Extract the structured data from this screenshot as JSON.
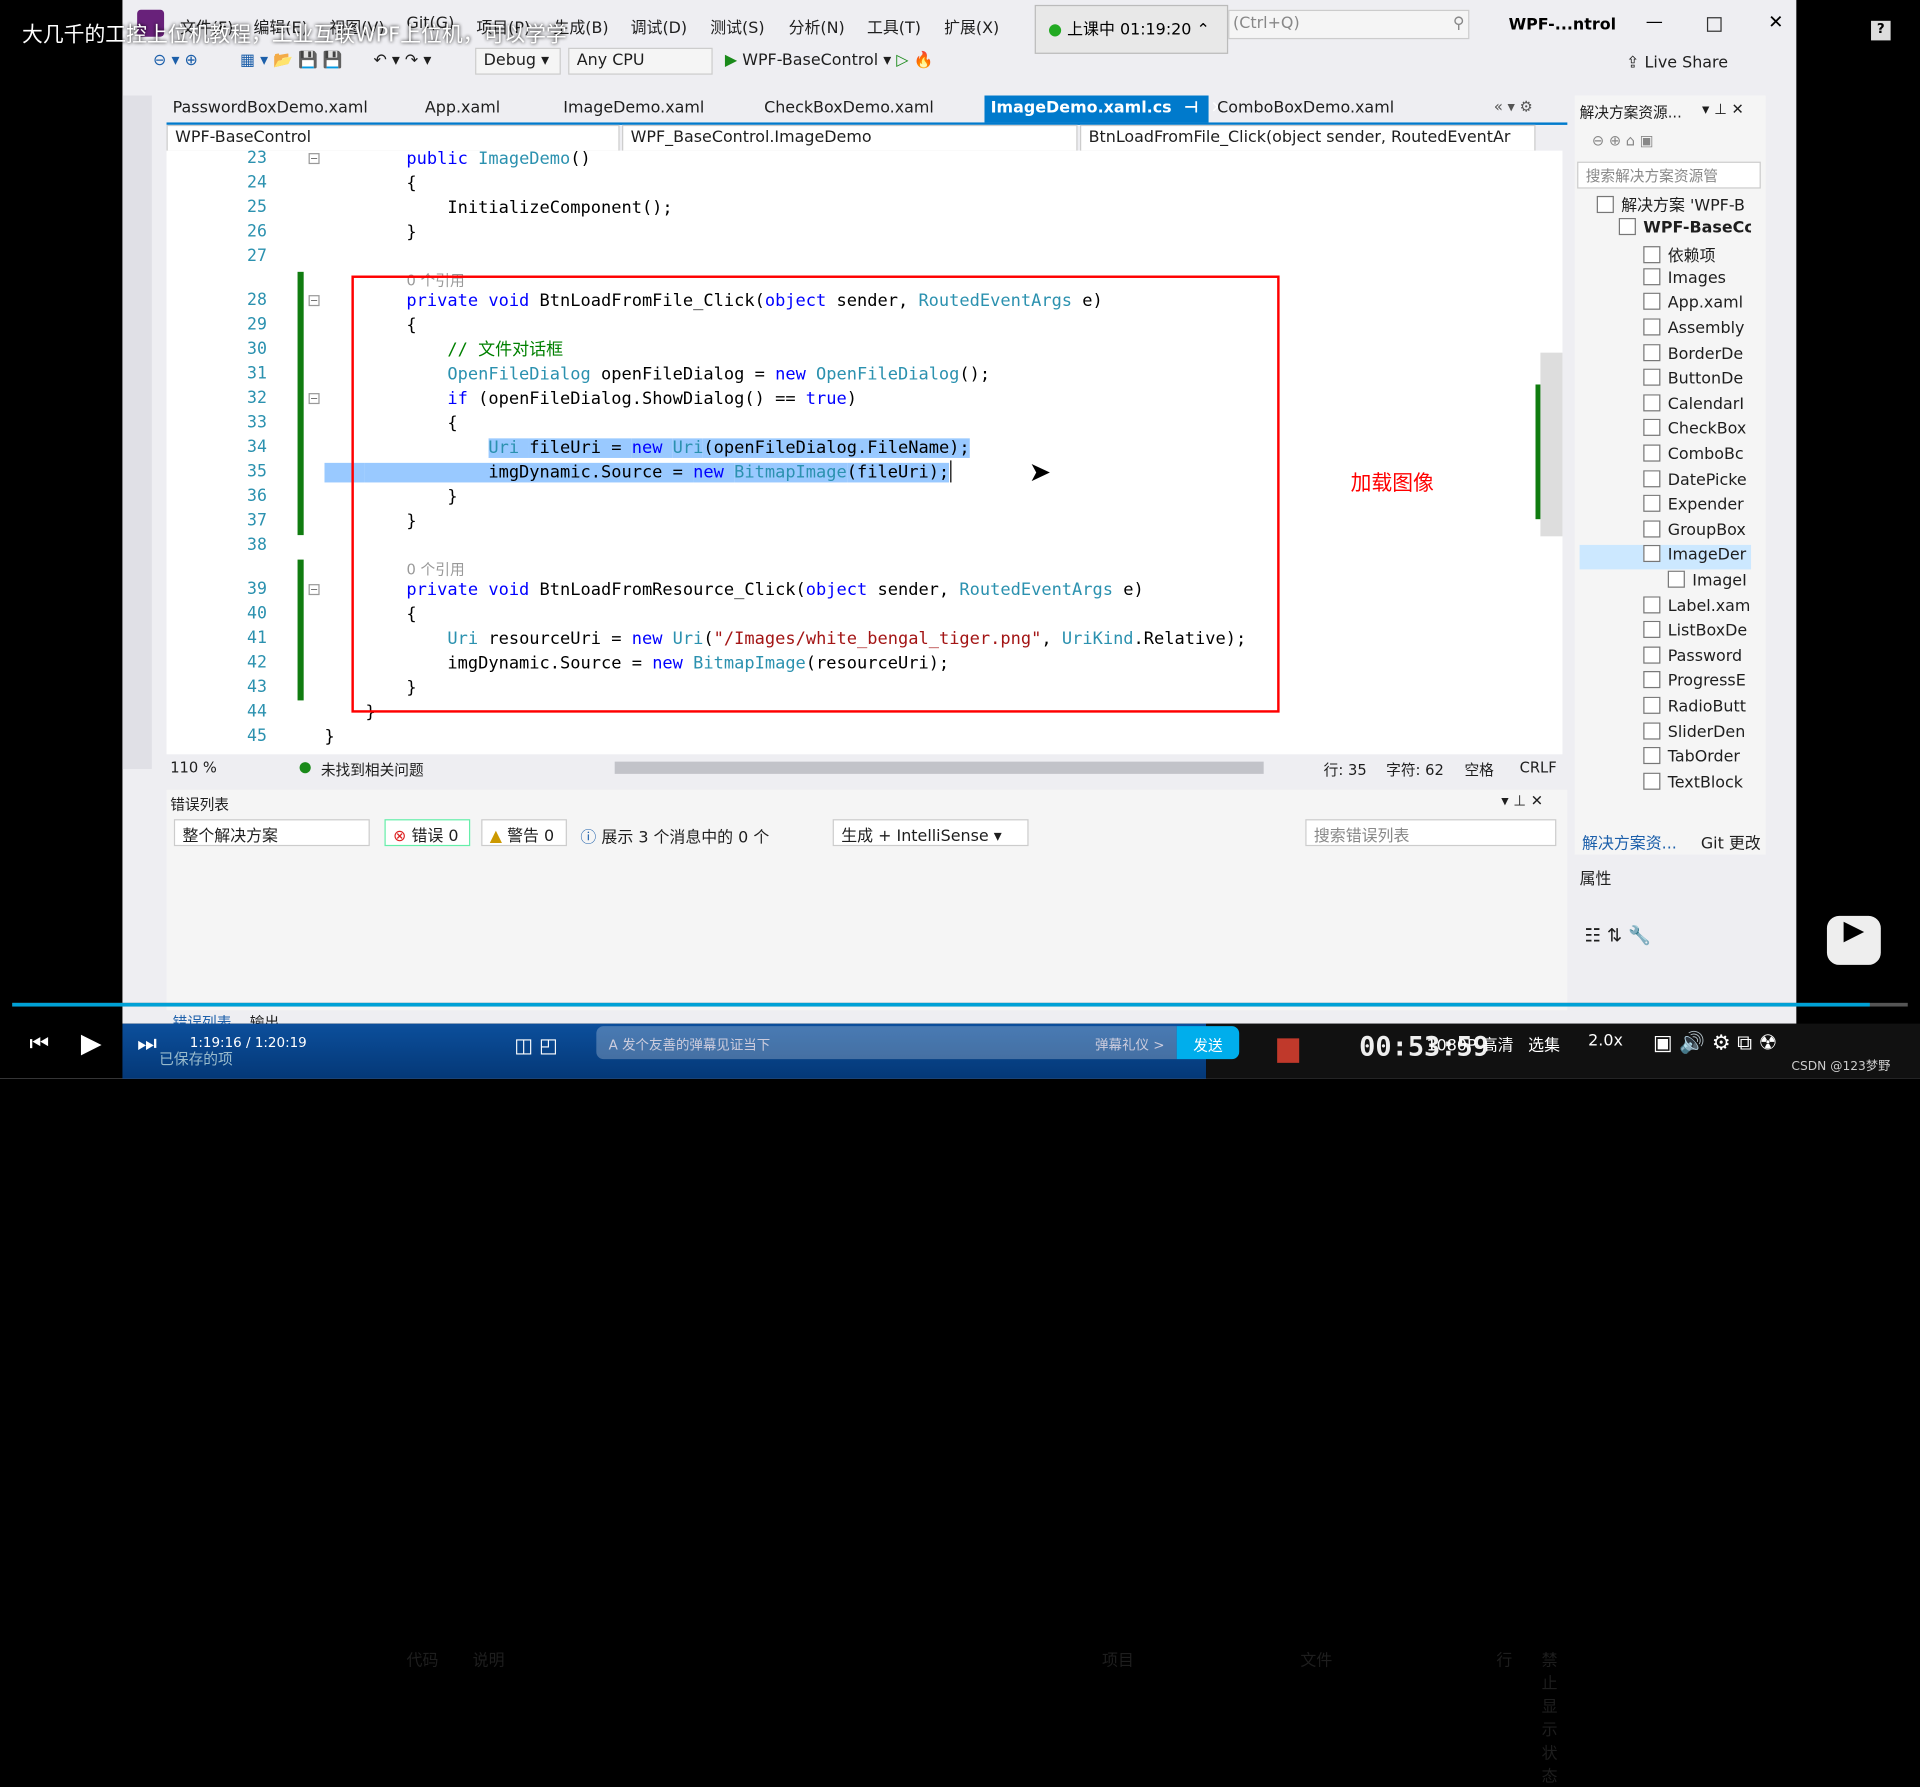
{
  "video_title": "大几千的工控上位机教程，工业互联WPF上位机，可以学学",
  "menu": [
    "文件(F)",
    "编辑(E)",
    "视图(V)",
    "Git(G)",
    "项目(P)",
    "生成(B)",
    "调试(D)",
    "测试(S)",
    "分析(N)",
    "工具(T)",
    "扩展(X)"
  ],
  "live_badge": "上课中 01:19:20",
  "search_hint": "(Ctrl+Q)",
  "window_title": "WPF-...ntrol",
  "toolbar": {
    "config": "Debug",
    "platform": "Any CPU",
    "start": "WPF-BaseControl",
    "live_share": "Live Share"
  },
  "tabs": [
    {
      "label": "PasswordBoxDemo.xaml"
    },
    {
      "label": "App.xaml"
    },
    {
      "label": "ImageDemo.xaml"
    },
    {
      "label": "CheckBoxDemo.xaml"
    },
    {
      "label": "ImageDemo.xaml.cs",
      "active": true
    },
    {
      "label": "ComboBoxDemo.xaml"
    }
  ],
  "navbar": {
    "project": "WPF-BaseControl",
    "class": "WPF_BaseControl.ImageDemo",
    "member": "BtnLoadFromFile_Click(object sender, RoutedEventAr"
  },
  "code": [
    {
      "n": "23",
      "t": [
        [
          "        "
        ],
        [
          "public ",
          "kw"
        ],
        [
          "ImageDemo",
          "ty"
        ],
        [
          "()"
        ]
      ]
    },
    {
      "n": "24",
      "t": [
        [
          "        {"
        ]
      ]
    },
    {
      "n": "25",
      "t": [
        [
          "            InitializeComponent();"
        ]
      ]
    },
    {
      "n": "26",
      "t": [
        [
          "        }"
        ]
      ]
    },
    {
      "n": "27",
      "t": [
        [
          ""
        ]
      ]
    },
    {
      "lens": "0 个引用"
    },
    {
      "n": "28",
      "t": [
        [
          "        "
        ],
        [
          "private void ",
          "kw"
        ],
        [
          "BtnLoadFromFile_Click("
        ],
        [
          "object ",
          "kw"
        ],
        [
          "sender, "
        ],
        [
          "RoutedEventArgs ",
          "ty"
        ],
        [
          "e)"
        ]
      ]
    },
    {
      "n": "29",
      "t": [
        [
          "        {"
        ]
      ]
    },
    {
      "n": "30",
      "t": [
        [
          "            "
        ],
        [
          "// 文件对话框",
          "cm"
        ]
      ]
    },
    {
      "n": "31",
      "t": [
        [
          "            "
        ],
        [
          "OpenFileDialog ",
          "ty"
        ],
        [
          "openFileDialog = "
        ],
        [
          "new ",
          "kw"
        ],
        [
          "OpenFileDialog",
          "ty"
        ],
        [
          "();"
        ]
      ]
    },
    {
      "n": "32",
      "t": [
        [
          "            "
        ],
        [
          "if ",
          "kw"
        ],
        [
          "(openFileDialog.ShowDialog() == "
        ],
        [
          "true",
          "kw"
        ],
        [
          ")"
        ]
      ]
    },
    {
      "n": "33",
      "t": [
        [
          "            {"
        ]
      ]
    },
    {
      "n": "34",
      "t": [
        [
          "                "
        ],
        [
          "Uri ",
          "ty sel"
        ],
        [
          "fileUri = ",
          "sel"
        ],
        [
          "new ",
          "kw sel"
        ],
        [
          "Uri",
          "ty sel"
        ],
        [
          "(openFileDialog.FileName);",
          "sel"
        ]
      ]
    },
    {
      "n": "35",
      "t": [
        [
          "    ",
          "sel"
        ],
        [
          "            imgDynamic.Source = ",
          "sel"
        ],
        [
          "new ",
          "kw sel"
        ],
        [
          "BitmapImage",
          "ty sel"
        ],
        [
          "(fileUri);",
          "sel"
        ]
      ]
    },
    {
      "n": "36",
      "t": [
        [
          "            }"
        ]
      ]
    },
    {
      "n": "37",
      "t": [
        [
          "        }"
        ]
      ]
    },
    {
      "n": "38",
      "t": [
        [
          ""
        ]
      ]
    },
    {
      "lens": "0 个引用"
    },
    {
      "n": "39",
      "t": [
        [
          "        "
        ],
        [
          "private void ",
          "kw"
        ],
        [
          "BtnLoadFromResource_Click("
        ],
        [
          "object ",
          "kw"
        ],
        [
          "sender, "
        ],
        [
          "RoutedEventArgs ",
          "ty"
        ],
        [
          "e)"
        ]
      ]
    },
    {
      "n": "40",
      "t": [
        [
          "        {"
        ]
      ]
    },
    {
      "n": "41",
      "t": [
        [
          "            "
        ],
        [
          "Uri ",
          "ty"
        ],
        [
          "resourceUri = "
        ],
        [
          "new ",
          "kw"
        ],
        [
          "Uri",
          "ty"
        ],
        [
          "("
        ],
        [
          "\"/Images/white_bengal_tiger.png\"",
          "st"
        ],
        [
          ", "
        ],
        [
          "UriKind",
          "ty"
        ],
        [
          ".Relative);"
        ]
      ]
    },
    {
      "n": "42",
      "t": [
        [
          "            imgDynamic.Source = "
        ],
        [
          "new ",
          "kw"
        ],
        [
          "BitmapImage",
          "ty"
        ],
        [
          "(resourceUri);"
        ]
      ]
    },
    {
      "n": "43",
      "t": [
        [
          "        }"
        ]
      ]
    },
    {
      "n": "44",
      "t": [
        [
          "    }"
        ]
      ]
    },
    {
      "n": "45",
      "t": [
        [
          "}"
        ]
      ]
    }
  ],
  "annotation": "加载图像",
  "status": {
    "zoom": "110 %",
    "issues": "未找到相关问题",
    "line": "行: 35",
    "char": "字符: 62",
    "space": "空格",
    "eol": "CRLF"
  },
  "error_list": {
    "title": "错误列表",
    "scope": "整个解决方案",
    "errors": "错误 0",
    "warnings": "警告 0",
    "messages": "展示 3 个消息中的 0 个",
    "source": "生成 + IntelliSense",
    "search": "搜索错误列表",
    "columns": [
      "代码",
      "说明",
      "项目",
      "文件",
      "行",
      "禁止显示状态"
    ]
  },
  "bottom_tabs": [
    "错误列表",
    "输出"
  ],
  "solution_explorer": {
    "title": "解决方案资源...",
    "search": "搜索解决方案资源管",
    "items": [
      {
        "label": "解决方案 'WPF-B",
        "lvl": 0
      },
      {
        "label": "WPF-BaseCc",
        "lvl": 0,
        "bold": true
      },
      {
        "label": "依赖项",
        "lvl": 1
      },
      {
        "label": "Images",
        "lvl": 1
      },
      {
        "label": "App.xaml",
        "lvl": 1
      },
      {
        "label": "Assembly",
        "lvl": 1
      },
      {
        "label": "BorderDe",
        "lvl": 1
      },
      {
        "label": "ButtonDe",
        "lvl": 1
      },
      {
        "label": "CalendarI",
        "lvl": 1
      },
      {
        "label": "CheckBox",
        "lvl": 1
      },
      {
        "label": "ComboBc",
        "lvl": 1
      },
      {
        "label": "DatePicke",
        "lvl": 1
      },
      {
        "label": "Expender",
        "lvl": 1
      },
      {
        "label": "GroupBox",
        "lvl": 1
      },
      {
        "label": "ImageDer",
        "lvl": 1,
        "selected": true
      },
      {
        "label": "ImageI",
        "lvl": 2
      },
      {
        "label": "Label.xam",
        "lvl": 1
      },
      {
        "label": "ListBoxDe",
        "lvl": 1
      },
      {
        "label": "Password",
        "lvl": 1
      },
      {
        "label": "ProgressE",
        "lvl": 1
      },
      {
        "label": "RadioButt",
        "lvl": 1
      },
      {
        "label": "SliderDen",
        "lvl": 1
      },
      {
        "label": "TabOrder",
        "lvl": 1
      },
      {
        "label": "TextBlock",
        "lvl": 1
      }
    ],
    "tabs": [
      "解决方案资...",
      "Git 更改"
    ],
    "properties": "属性"
  },
  "player": {
    "time": "1:19:16 / 1:20:19",
    "saved": "已保存的项",
    "danmaku_placeholder": "发个友善的弹幕见证当下",
    "etiquette": "弹幕礼仪 >",
    "send": "发送",
    "clock": "00:53:59",
    "quality": "1080P 高清",
    "episodes": "选集",
    "speed": "2.0x",
    "progress": 0.98,
    "watermark": "CSDN @123梦野"
  },
  "colors": {
    "accent": "#007acc",
    "annotation": "#ff0000",
    "selection": "#99c9ff",
    "send": "#00aeec"
  }
}
